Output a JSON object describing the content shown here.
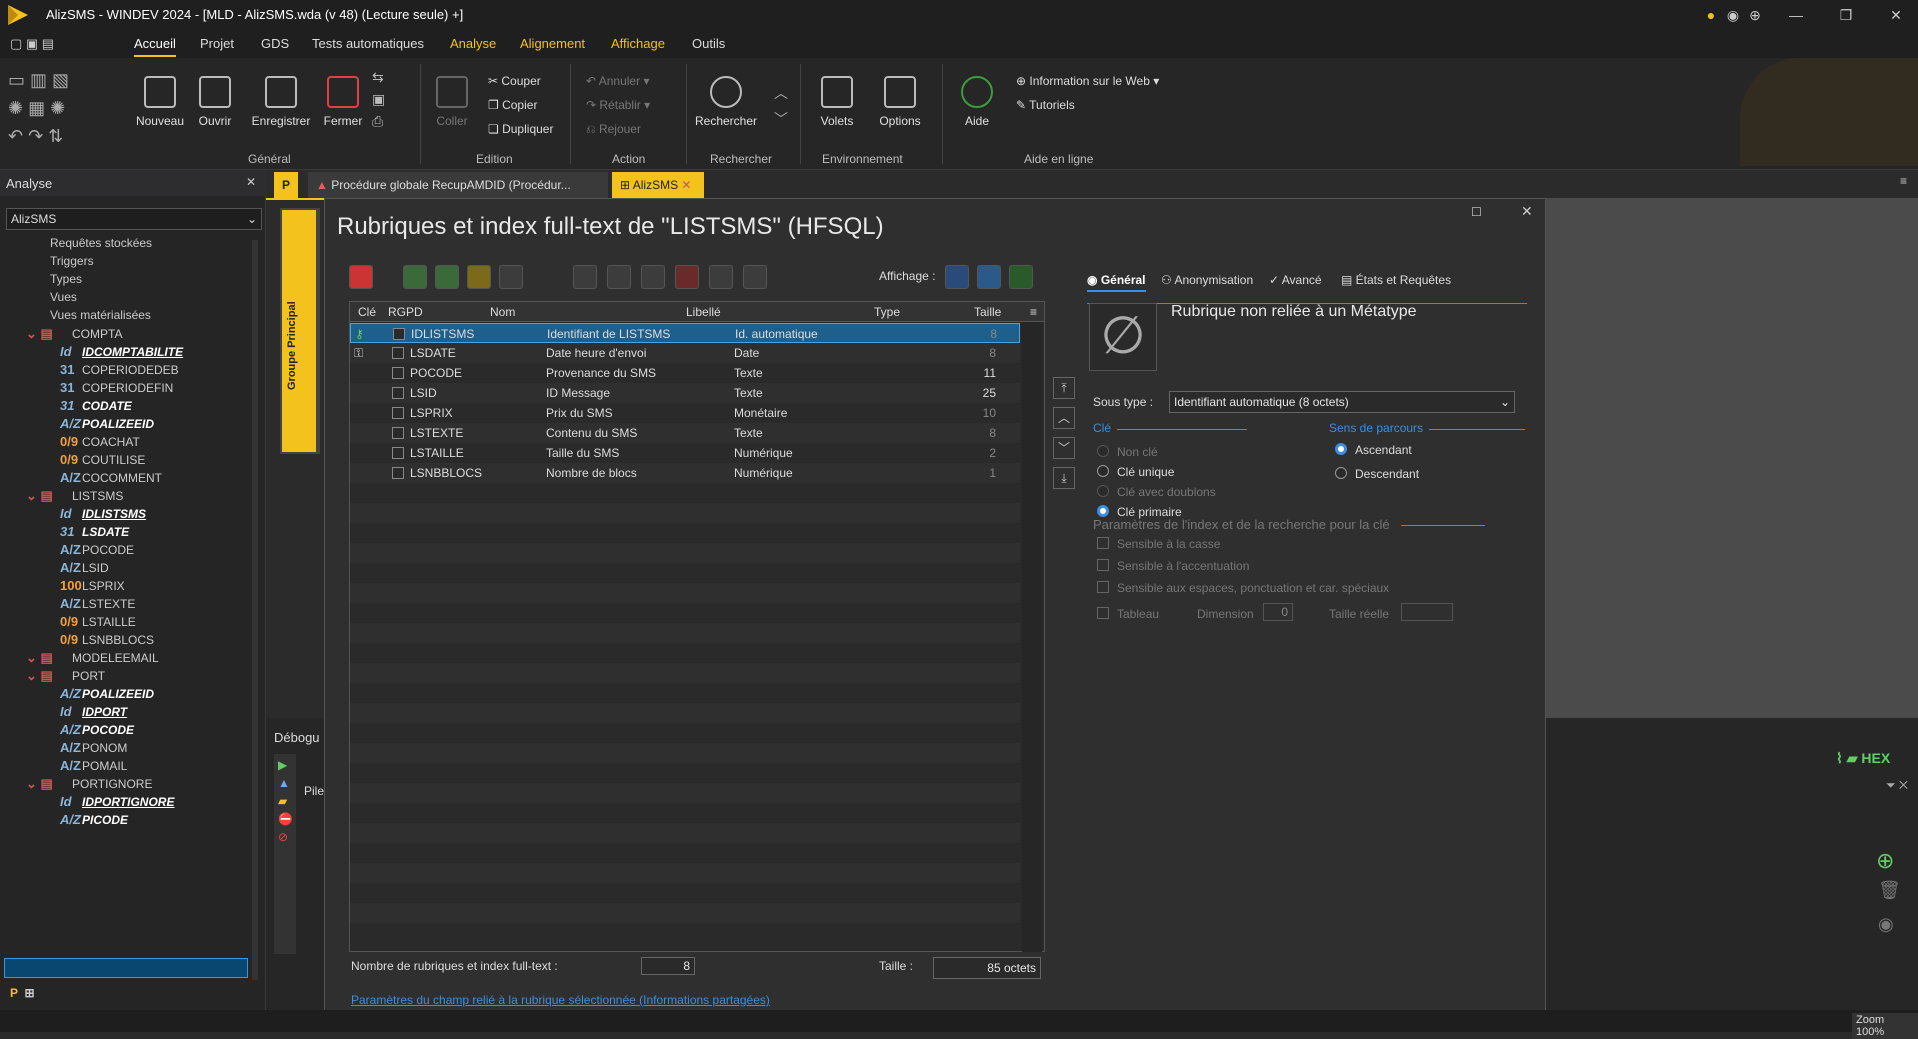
{
  "window": {
    "title": "AlizSMS - WINDEV 2024 - [MLD - AlizSMS.wda (v 48) (Lecture seule) +]"
  },
  "menu": [
    "Accueil",
    "Projet",
    "GDS",
    "Tests automatiques",
    "Analyse",
    "Alignement",
    "Affichage",
    "Outils"
  ],
  "ribbon": {
    "general": {
      "nouveau": "Nouveau",
      "ouvrir": "Ouvrir",
      "enregistrer": "Enregistrer",
      "fermer": "Fermer",
      "group": "Général"
    },
    "edition": {
      "coller": "Coller",
      "couper": "Couper",
      "copier": "Copier",
      "dupliquer": "Dupliquer",
      "group": "Edition"
    },
    "action": {
      "annuler": "Annuler",
      "retablir": "Rétablir",
      "rejouer": "Rejouer",
      "group": "Action"
    },
    "rechercher": {
      "label": "Rechercher",
      "group": "Rechercher"
    },
    "environnement": {
      "volets": "Volets",
      "options": "Options",
      "group": "Environnement"
    },
    "aide": {
      "aide": "Aide",
      "info_web": "Information sur le Web",
      "tutoriels": "Tutoriels",
      "group": "Aide en ligne"
    }
  },
  "left_panel": {
    "title": "Analyse",
    "combo": "AlizSMS",
    "items": [
      {
        "label": "Requêtes stockées",
        "tag": ""
      },
      {
        "label": "Triggers",
        "tag": ""
      },
      {
        "label": "Types",
        "tag": ""
      },
      {
        "label": "Vues",
        "tag": ""
      },
      {
        "label": "Vues matérialisées",
        "tag": ""
      },
      {
        "label": "COMPTA",
        "tag": "▤"
      },
      {
        "label": "IDCOMPTABILITE",
        "tag": "Id"
      },
      {
        "label": "COPERIODEDEB",
        "tag": "31"
      },
      {
        "label": "COPERIODEFIN",
        "tag": "31"
      },
      {
        "label": "CODATE",
        "tag": "31"
      },
      {
        "label": "POALIZEEID",
        "tag": "A/Z"
      },
      {
        "label": "COACHAT",
        "tag": "0/9"
      },
      {
        "label": "COUTILISE",
        "tag": "0/9"
      },
      {
        "label": "COCOMMENT",
        "tag": "A/Z"
      },
      {
        "label": "LISTSMS",
        "tag": "▤"
      },
      {
        "label": "IDLISTSMS",
        "tag": "Id"
      },
      {
        "label": "LSDATE",
        "tag": "31"
      },
      {
        "label": "POCODE",
        "tag": "A/Z"
      },
      {
        "label": "LSID",
        "tag": "A/Z"
      },
      {
        "label": "LSPRIX",
        "tag": "100"
      },
      {
        "label": "LSTEXTE",
        "tag": "A/Z"
      },
      {
        "label": "LSTAILLE",
        "tag": "0/9"
      },
      {
        "label": "LSNBBLOCS",
        "tag": "0/9"
      },
      {
        "label": "MODELEEMAIL",
        "tag": "▤"
      },
      {
        "label": "PORT",
        "tag": "▤"
      },
      {
        "label": "POALIZEEID",
        "tag": "A/Z"
      },
      {
        "label": "IDPORT",
        "tag": "Id"
      },
      {
        "label": "POCODE",
        "tag": "A/Z"
      },
      {
        "label": "PONOM",
        "tag": "A/Z"
      },
      {
        "label": "POMAIL",
        "tag": "A/Z"
      },
      {
        "label": "PORTIGNORE",
        "tag": "▤"
      },
      {
        "label": "IDPORTIGNORE",
        "tag": "Id"
      },
      {
        "label": "PICODE",
        "tag": "A/Z"
      }
    ]
  },
  "tabs": [
    {
      "label": "P"
    },
    {
      "label": "Procédure globale RecupAMDID (Procédur..."
    },
    {
      "label": "AlizSMS"
    }
  ],
  "side_group": "Groupe Principal",
  "dialog": {
    "title": "Rubriques et index full-text de \"LISTSMS\" (HFSQL)",
    "affichage_label": "Affichage :",
    "columns": [
      "Clé",
      "RGPD",
      "Nom",
      "Libellé",
      "Type",
      "Taille"
    ],
    "rows": [
      {
        "nom": "IDLISTSMS",
        "libelle": "Identifiant de LISTSMS",
        "type": "Id. automatique",
        "taille": "8"
      },
      {
        "nom": "LSDATE",
        "libelle": "Date heure d'envoi",
        "type": "Date",
        "taille": "8"
      },
      {
        "nom": "POCODE",
        "libelle": "Provenance du SMS",
        "type": "Texte",
        "taille": "11"
      },
      {
        "nom": "LSID",
        "libelle": "ID Message",
        "type": "Texte",
        "taille": "25"
      },
      {
        "nom": "LSPRIX",
        "libelle": "Prix du SMS",
        "type": "Monétaire",
        "taille": "10"
      },
      {
        "nom": "LSTEXTE",
        "libelle": "Contenu du SMS",
        "type": "Texte",
        "taille": "8"
      },
      {
        "nom": "LSTAILLE",
        "libelle": "Taille du SMS",
        "type": "Numérique",
        "taille": "2"
      },
      {
        "nom": "LSNBBLOCS",
        "libelle": "Nombre de blocs",
        "type": "Numérique",
        "taille": "1"
      }
    ],
    "nb_label": "Nombre de rubriques et index full-text :",
    "nb_value": "8",
    "taille_label": "Taille :",
    "taille_value": "85 octets",
    "link": "Paramètres du champ relié à la rubrique sélectionnée (Informations partagées)",
    "right_tabs": [
      "Général",
      "Anonymisation",
      "Avancé",
      "États et Requêtes"
    ],
    "metatype": "Rubrique non reliée à un Métatype",
    "sous_type_label": "Sous type :",
    "sous_type_value": "Identifiant automatique (8 octets)",
    "cle_title": "Clé",
    "cle_options": [
      "Non clé",
      "Clé unique",
      "Clé avec doublons",
      "Clé primaire"
    ],
    "sens_title": "Sens de parcours",
    "sens_options": [
      "Ascendant",
      "Descendant"
    ],
    "params_title": "Paramètres de l'index et de la recherche pour la clé",
    "params_options": [
      "Sensible à la casse",
      "Sensible à l'accentuation",
      "Sensible aux espaces, ponctuation et car. spéciaux"
    ],
    "tableau": "Tableau",
    "dimension_label": "Dimension",
    "dimension_value": "0",
    "taille_reelle": "Taille réelle"
  },
  "debug": {
    "title": "Débogu",
    "pile": "Pile"
  },
  "status": {
    "zoom": "Zoom 100%"
  },
  "colors": {
    "accent": "#f3c21c",
    "selection": "#1f5f8b",
    "link": "#3b8ee0"
  }
}
